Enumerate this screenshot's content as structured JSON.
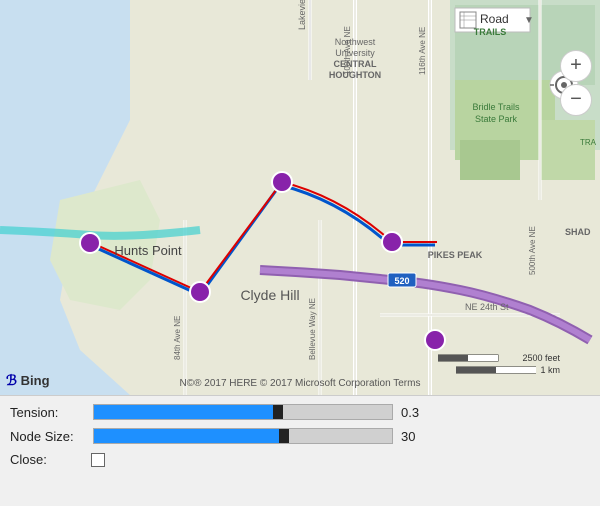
{
  "map": {
    "type_selector": {
      "label": "Road",
      "dropdown_arrow": "▼"
    },
    "zoom_plus": "+",
    "zoom_minus": "−",
    "bing_label": "Bing",
    "copyright": "N©® 2017 HERE © 2017 Microsoft Corporation  Terms",
    "scale_2500": "2500 feet",
    "scale_1km": "1 km",
    "labels": {
      "hunts_point": "Hunts Point",
      "clyde_hill": "Clyde Hill",
      "bridle_trails": "Bridle Trails",
      "state_park": "State Park",
      "northwest_university": "Northwest",
      "central_houghton": "University",
      "central_houghton2": "CENTRAL",
      "central_houghton3": "HOUGHTON",
      "trails": "TRAILS",
      "pikes_peak": "PIKES PEAK",
      "shad": "SHAD",
      "tra": "TRA",
      "ne_24th": "NE 24th St",
      "road_520": "520"
    }
  },
  "controls": {
    "tension": {
      "label": "Tension:",
      "value": "0.3",
      "fill_percent": 60
    },
    "node_size": {
      "label": "Node Size:",
      "value": "30",
      "fill_percent": 62
    },
    "close": {
      "label": "Close:",
      "checked": false
    }
  }
}
